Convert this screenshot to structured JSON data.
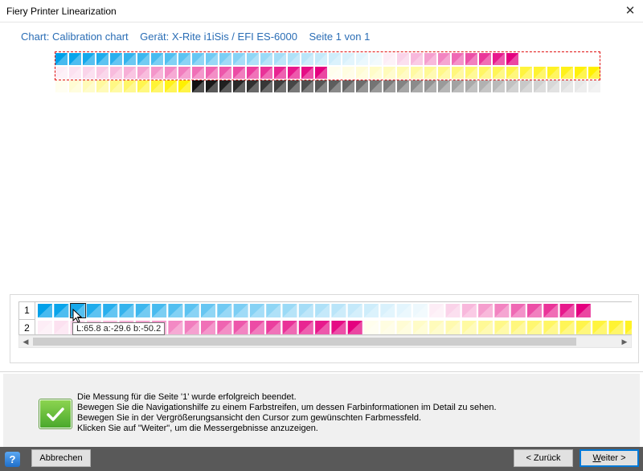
{
  "window": {
    "title": "Fiery Printer Linearization"
  },
  "header": {
    "chart_label": "Chart: Calibration chart",
    "device_label": "Gerät: X-Rite i1iSis / EFI ES-6000",
    "page_label": "Seite 1 von 1"
  },
  "zoom": {
    "row_labels": [
      "1",
      "2"
    ],
    "tooltip": "L:65.8 a:-29.6 b:-50.2"
  },
  "messages": [
    "Die Messung für die Seite '1' wurde erfolgreich beendet.",
    "Bewegen Sie die Navigationshilfe zu einem Farbstreifen, um dessen Farbinformationen im Detail zu sehen.",
    "Bewegen Sie in der Vergrößerungsansicht den Cursor zum gewünschten Farbmessfeld.",
    "Klicken Sie auf \"Weiter\", um die Messergebnisse anzuzeigen."
  ],
  "buttons": {
    "cancel": "Abbrechen",
    "back": "< Zurück",
    "next_underlined": "W",
    "next_rest": "eiter >",
    "help": "?"
  },
  "colors": {
    "cyan": "#00a0e9",
    "magenta": "#e4007f",
    "yellow": "#fff000",
    "black": "#111111",
    "accent": "#0078d7",
    "header_text": "#2a6db5"
  },
  "chart_rows": [
    {
      "segments": [
        {
          "ink": "cyan",
          "count": 24
        },
        {
          "ink": "magenta",
          "count": 10
        }
      ]
    },
    {
      "segments": [
        {
          "ink": "magenta",
          "count": 20
        },
        {
          "ink": "yellow",
          "count": 20
        }
      ]
    },
    {
      "segments": [
        {
          "ink": "yellow",
          "count": 10
        },
        {
          "ink": "black",
          "count": 30
        }
      ]
    }
  ]
}
